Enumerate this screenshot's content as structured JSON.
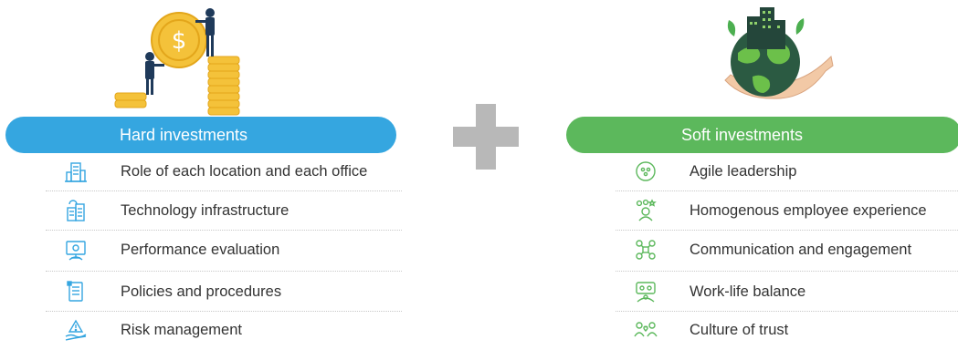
{
  "hard": {
    "title": "Hard investments",
    "color": "#35a6e0",
    "items": [
      {
        "label": "Role of each location and each office",
        "icon": "office-building-icon"
      },
      {
        "label": "Technology infrastructure",
        "icon": "technology-building-icon"
      },
      {
        "label": "Performance evaluation",
        "icon": "performance-evaluation-icon"
      },
      {
        "label": "Policies and procedures",
        "icon": "policy-document-icon"
      },
      {
        "label": "Risk management",
        "icon": "risk-hand-icon"
      }
    ]
  },
  "soft": {
    "title": "Soft investments",
    "color": "#5cb85c",
    "items": [
      {
        "label": "Agile leadership",
        "icon": "agile-leadership-icon"
      },
      {
        "label": "Homogenous employee experience",
        "icon": "employee-experience-icon"
      },
      {
        "label": "Communication and engagement",
        "icon": "communication-network-icon"
      },
      {
        "label": "Work-life balance",
        "icon": "work-life-balance-icon"
      },
      {
        "label": "Culture of trust",
        "icon": "trust-people-icon"
      }
    ]
  },
  "plus_color": "#b8b8b8"
}
